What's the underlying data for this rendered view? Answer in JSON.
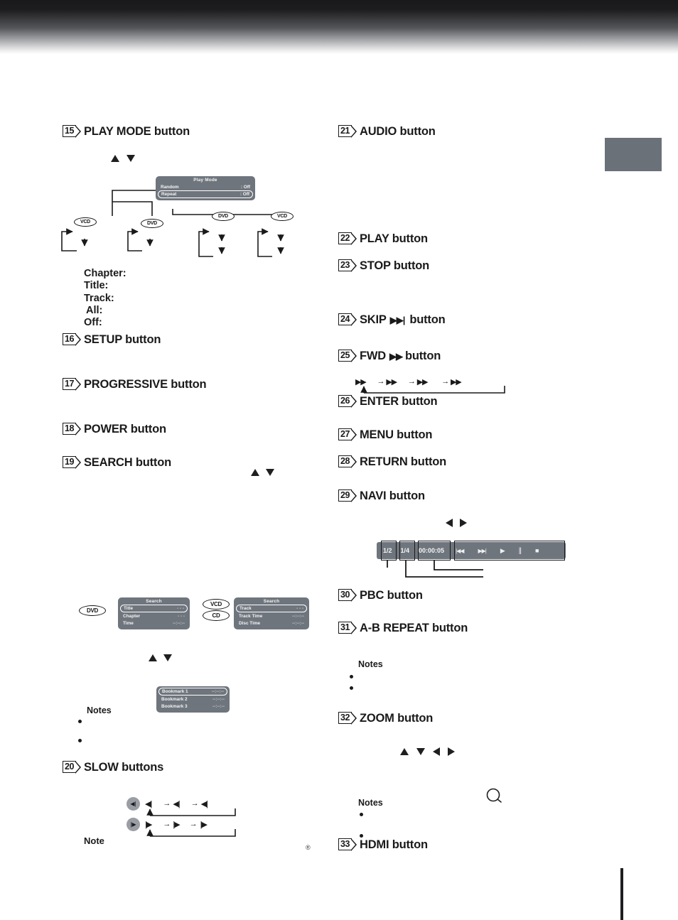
{
  "page": {
    "side_tab_color": "#6b7179",
    "osd_bg_color": "#6f757d"
  },
  "left_column": {
    "items": [
      {
        "num": "15",
        "label": "PLAY MODE button"
      },
      {
        "num": "16",
        "label": "SETUP button"
      },
      {
        "num": "17",
        "label": "PROGRESSIVE button"
      },
      {
        "num": "18",
        "label": "POWER button"
      },
      {
        "num": "19",
        "label": "SEARCH button"
      },
      {
        "num": "20",
        "label": "SLOW buttons"
      }
    ],
    "play_mode_osd": {
      "title": "Play Mode",
      "rows": [
        {
          "label": "Random",
          "value": ": Off",
          "selected": false
        },
        {
          "label": "Repeat",
          "value": ": Off",
          "selected": true
        }
      ]
    },
    "play_mode_branches": [
      {
        "disc": "VCD"
      },
      {
        "disc": "DVD"
      },
      {
        "disc": "DVD"
      },
      {
        "disc": "VCD"
      }
    ],
    "repeat_modes": [
      "Chapter:",
      "Title:",
      "Track:",
      "All:",
      "Off:"
    ],
    "search_osd_dvd": {
      "disc_badges": [
        "DVD"
      ],
      "title": "Search",
      "rows": [
        {
          "label": "Title",
          "value": "- - -",
          "selected": true
        },
        {
          "label": "Chapter",
          "value": "- - -",
          "selected": false
        },
        {
          "label": "Time",
          "value": "--:--:--",
          "selected": false
        }
      ]
    },
    "search_osd_vcd_cd": {
      "disc_badges": [
        "VCD",
        "CD"
      ],
      "title": "Search",
      "rows": [
        {
          "label": "Track",
          "value": "- - -",
          "selected": true
        },
        {
          "label": "Track Time",
          "value": "--:--:--",
          "selected": false
        },
        {
          "label": "Disc Time",
          "value": "--:--:--",
          "selected": false
        }
      ]
    },
    "bookmark_osd": {
      "rows": [
        {
          "label": "Bookmark 1",
          "value": "--:--:--",
          "selected": true
        },
        {
          "label": "Bookmark 2",
          "value": "--:--:--",
          "selected": false
        },
        {
          "label": "Bookmark 3",
          "value": "--:--:--",
          "selected": false
        }
      ]
    },
    "notes_heading": "Notes",
    "note_heading": "Note",
    "slow_rows": [
      {
        "icon": "slow-reverse-icon",
        "steps": [
          "◀|",
          "◀|",
          "◀|"
        ]
      },
      {
        "icon": "slow-forward-icon",
        "steps": [
          "|▶",
          "|▶",
          "|▶"
        ]
      }
    ],
    "registered_mark": "®"
  },
  "right_column": {
    "items": [
      {
        "num": "21",
        "label": "AUDIO button"
      },
      {
        "num": "22",
        "label": "PLAY button"
      },
      {
        "num": "23",
        "label": "STOP button"
      },
      {
        "num": "24",
        "label": "SKIP",
        "suffix": "button",
        "glyph": "▶▶|"
      },
      {
        "num": "25",
        "label": "FWD",
        "suffix": "button",
        "glyph": "▶▶"
      },
      {
        "num": "26",
        "label": "ENTER button"
      },
      {
        "num": "27",
        "label": "MENU button"
      },
      {
        "num": "28",
        "label": "RETURN button"
      },
      {
        "num": "29",
        "label": "NAVI button"
      },
      {
        "num": "30",
        "label": "PBC button"
      },
      {
        "num": "31",
        "label": "A-B REPEAT button"
      },
      {
        "num": "32",
        "label": "ZOOM button"
      },
      {
        "num": "33",
        "label": "HDMI button"
      }
    ],
    "fwd_speed_steps": [
      "▶▶",
      "▶▶",
      "▶▶",
      "▶▶"
    ],
    "navi_toolbar": {
      "title_index": "1/2",
      "chapter_index": "1/4",
      "elapsed_time": "00:00:05",
      "transport": [
        {
          "name": "prev-icon",
          "glyph": "|◀◀"
        },
        {
          "name": "next-icon",
          "glyph": "▶▶|"
        },
        {
          "name": "play-icon",
          "glyph": "▶"
        },
        {
          "name": "pause-icon",
          "glyph": "||"
        },
        {
          "name": "stop-icon",
          "glyph": "■"
        }
      ]
    },
    "ab_repeat_notes_heading": "Notes",
    "zoom_notes_heading": "Notes"
  }
}
